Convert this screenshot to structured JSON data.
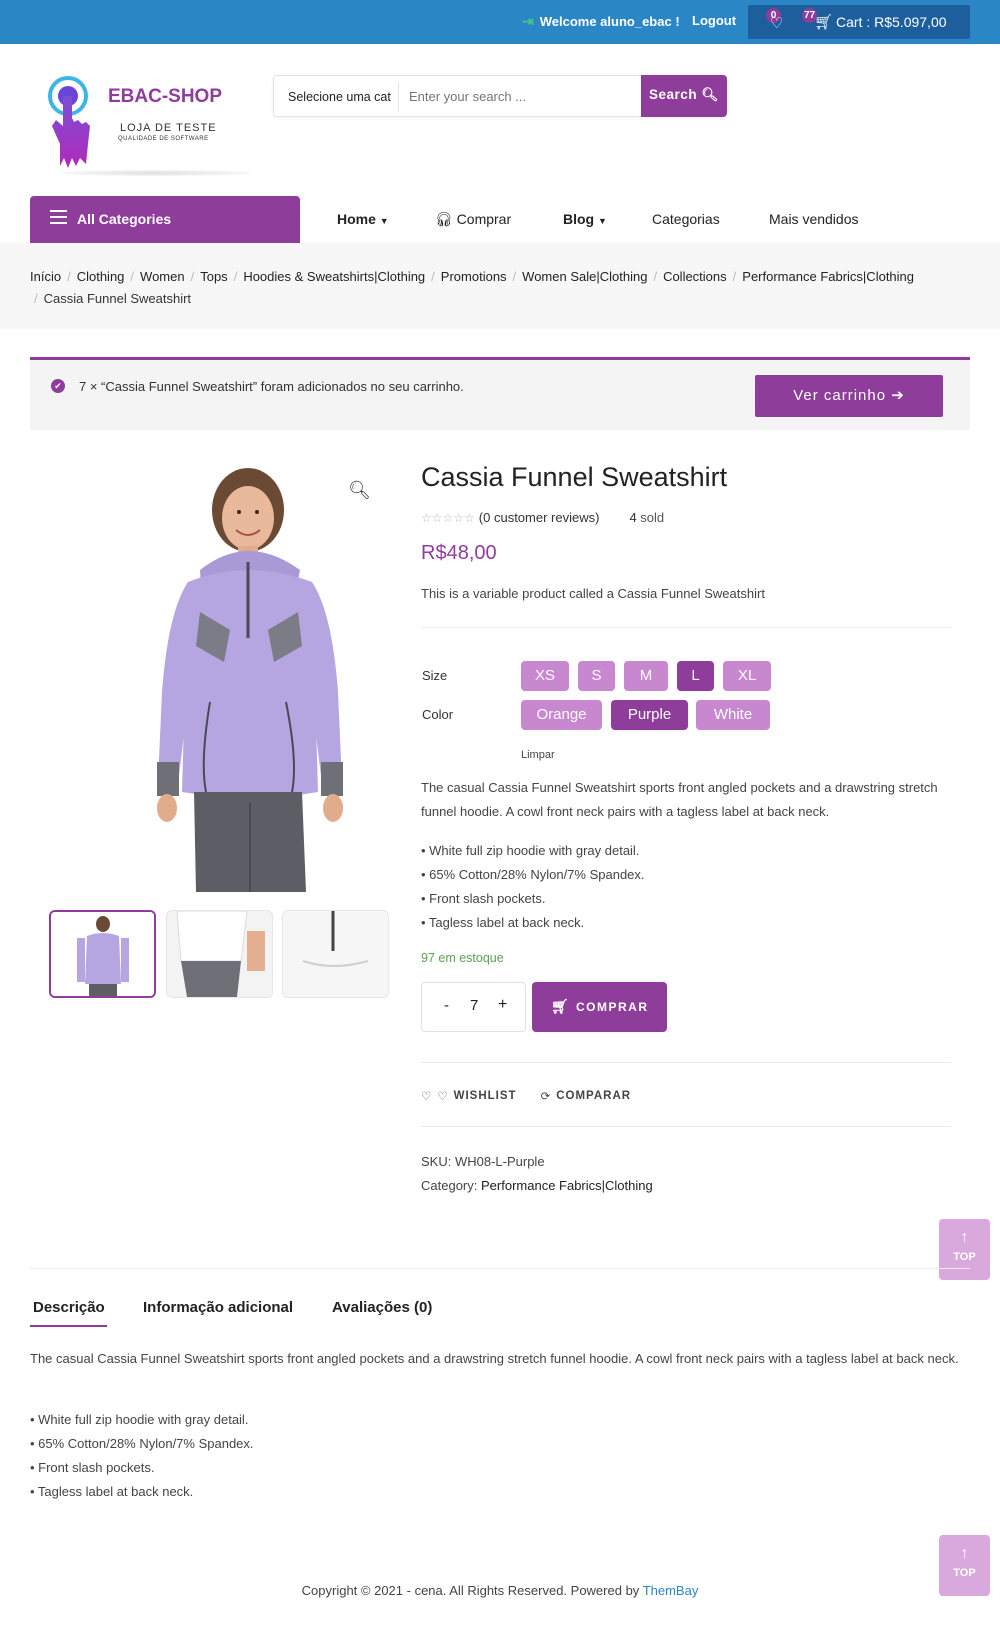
{
  "topbar": {
    "welcome": "Welcome aluno_ebac !",
    "logout": "Logout",
    "wishlist_count": "0",
    "cart_count": "77",
    "cart_label": "Cart : R$5.097,00"
  },
  "header": {
    "brand": "EBAC-SHOP",
    "tagline": "LOJA DE TESTE",
    "tagline_small": "QUALIDADE DE SOFTWARE",
    "search_category": "Selecione uma cat",
    "search_placeholder": "Enter your search ...",
    "search_button": "Search"
  },
  "nav": {
    "all_categories": "All Categories",
    "items": [
      "Home",
      "Comprar",
      "Blog",
      "Categorias",
      "Mais vendidos"
    ]
  },
  "breadcrumb": [
    "Início",
    "Clothing",
    "Women",
    "Tops",
    "Hoodies & Sweatshirts|Clothing",
    "Promotions",
    "Women Sale|Clothing",
    "Collections",
    "Performance Fabrics|Clothing",
    "Cassia Funnel Sweatshirt"
  ],
  "notice": {
    "message": "7 × “Cassia Funnel Sweatshirt” foram adicionados no seu carrinho.",
    "button": "Ver carrinho"
  },
  "product": {
    "title": "Cassia Funnel Sweatshirt",
    "stars": "☆☆☆☆☆",
    "reviews": "(0 customer reviews)",
    "sold_count": "4",
    "sold_label": "sold",
    "price": "R$48,00",
    "short_desc": "This is a variable product called a Cassia Funnel Sweatshirt",
    "size_label": "Size",
    "sizes": [
      "XS",
      "S",
      "M",
      "L",
      "XL"
    ],
    "selected_size": "L",
    "color_label": "Color",
    "colors": [
      "Orange",
      "Purple",
      "White"
    ],
    "selected_color": "Purple",
    "clear": "Limpar",
    "long_desc": "The casual Cassia Funnel Sweatshirt sports front angled pockets and a drawstring stretch funnel hoodie. A cowl front neck pairs with a tagless label at back neck.",
    "bullets": [
      "• White full zip hoodie with gray detail.",
      "• 65% Cotton/28% Nylon/7% Spandex.",
      "• Front slash pockets.",
      "• Tagless label at back neck."
    ],
    "stock": "97 em estoque",
    "qty_minus": "-",
    "qty_value": "7",
    "qty_plus": "+",
    "buy_button": "COMPRAR",
    "wishlist": "WISHLIST",
    "compare": "COMPARAR",
    "sku_label": "SKU:",
    "sku": "WH08-L-Purple",
    "category_label": "Category:",
    "category": "Performance Fabrics|Clothing"
  },
  "top_button": "TOP",
  "tabs": {
    "items": [
      "Descrição",
      "Informação adicional",
      "Avaliações (0)"
    ],
    "content": "The casual Cassia Funnel Sweatshirt sports front angled pockets and a drawstring stretch funnel hoodie. A cowl front neck pairs with a tagless label at back neck.",
    "bullets": [
      "• White full zip hoodie with gray detail.",
      "• 65% Cotton/28% Nylon/7% Spandex.",
      "• Front slash pockets.",
      "• Tagless label at back neck."
    ]
  },
  "footer": {
    "text": "Copyright © 2021 - cena. All Rights Reserved. Powered by",
    "link": "ThemBay"
  },
  "colors": {
    "accent": "#8e3d9a",
    "topbar": "#2b86c5",
    "swatch": "#c888cf",
    "stock": "#5aa155"
  }
}
